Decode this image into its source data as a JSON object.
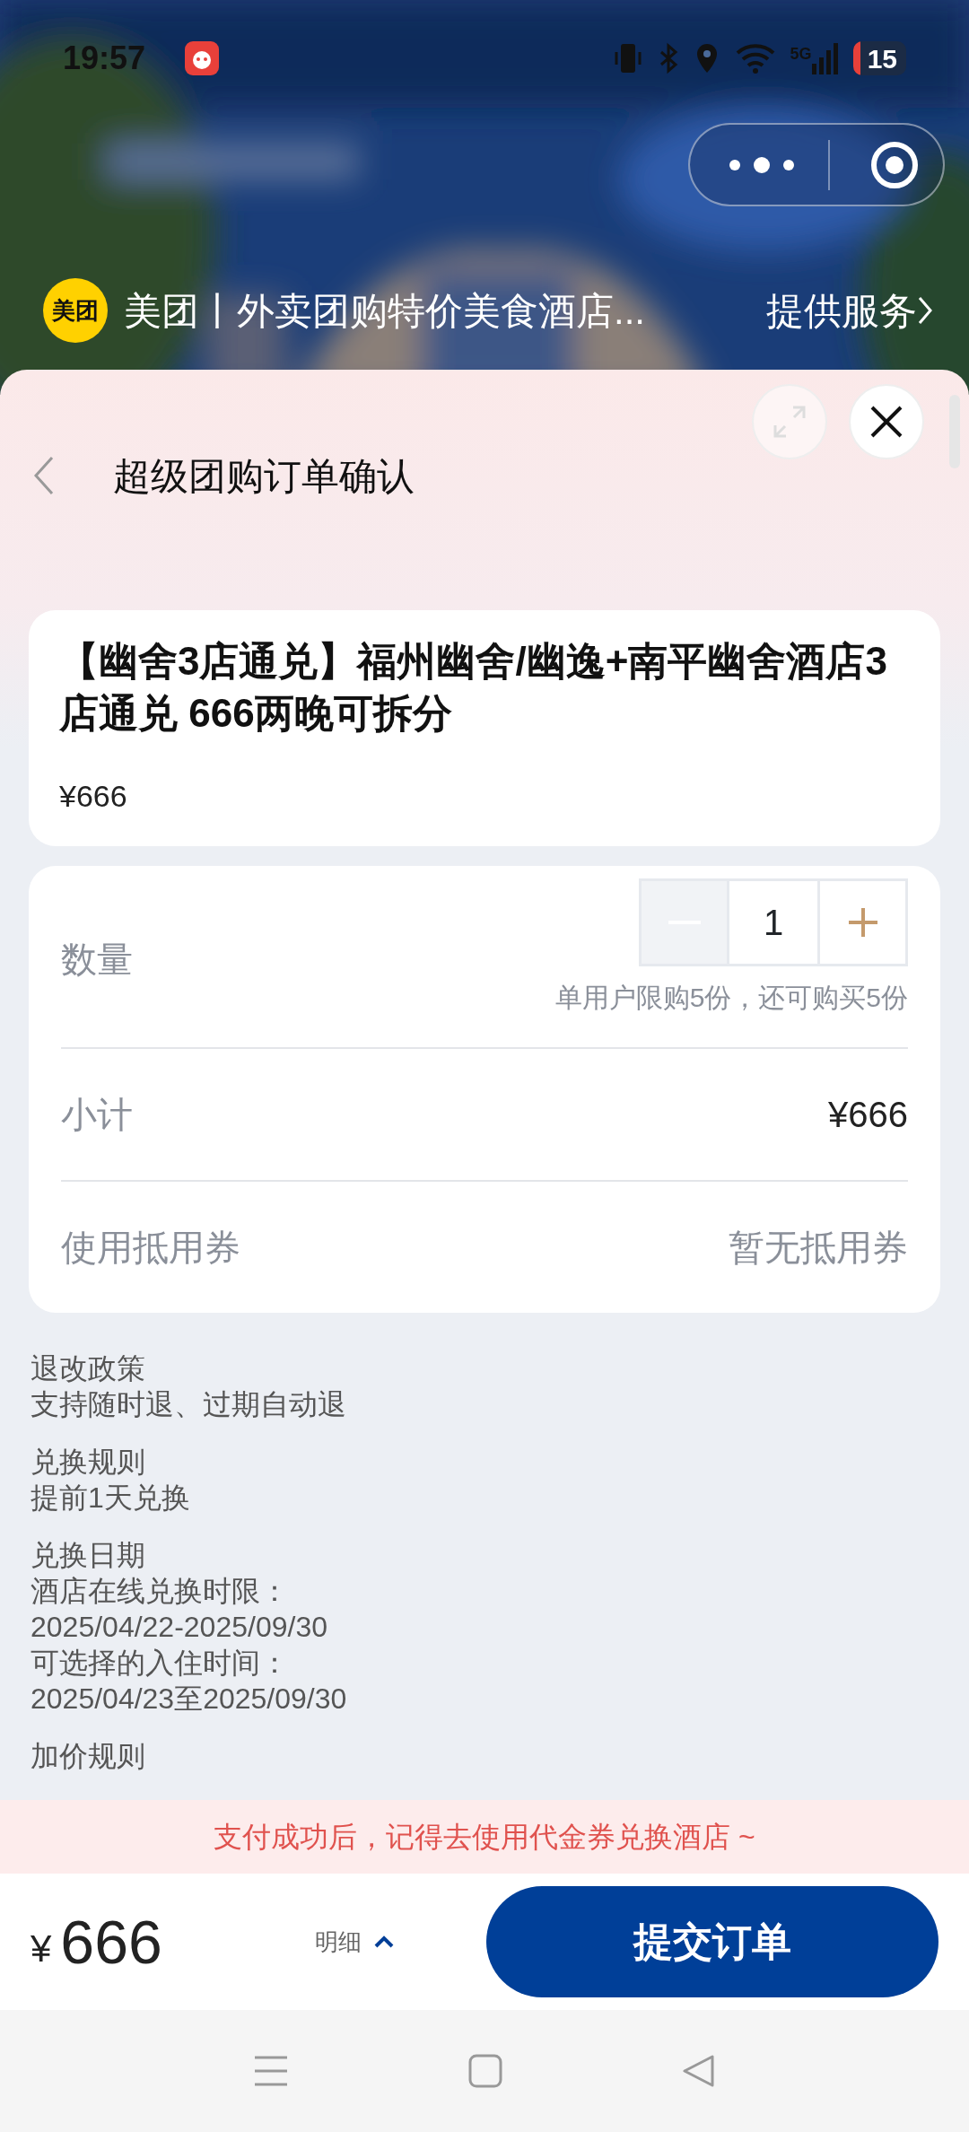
{
  "status_bar": {
    "time": "19:57",
    "network": "5G",
    "battery": "15"
  },
  "mini_program": {
    "logo_text": "美团",
    "name": "美团丨外卖团购特价美食酒店...",
    "service_link": "提供服务"
  },
  "page": {
    "title": "超级团购订单确认"
  },
  "product": {
    "title": "【幽舍3店通兑】福州幽舍/幽逸+南平幽舍酒店3店通兑 666两晚可拆分",
    "price": "¥666"
  },
  "quantity": {
    "label": "数量",
    "value": "1",
    "minus_disabled": true,
    "limit_note": "单用户限购5份，还可购买5份"
  },
  "rows": [
    {
      "label": "小计",
      "value": "¥666",
      "kind": "price"
    },
    {
      "label": "使用抵用券",
      "value": "暂无抵用券",
      "kind": "link"
    }
  ],
  "policies": [
    {
      "title": "退改政策",
      "lines": [
        "支持随时退、过期自动退"
      ]
    },
    {
      "title": "兑换规则",
      "lines": [
        "提前1天兑换"
      ]
    },
    {
      "title": "兑换日期",
      "lines": [
        "酒店在线兑换时限：",
        "2025/04/22-2025/09/30",
        "可选择的入住时间：",
        "2025/04/23至2025/09/30"
      ]
    },
    {
      "title": "加价规则"
    }
  ],
  "banner": "支付成功后，记得去使用代金券兑换酒店 ~",
  "footer": {
    "currency": "¥",
    "total": "666",
    "detail_label": "明细",
    "detail_expanded": false,
    "submit": "提交订单"
  }
}
